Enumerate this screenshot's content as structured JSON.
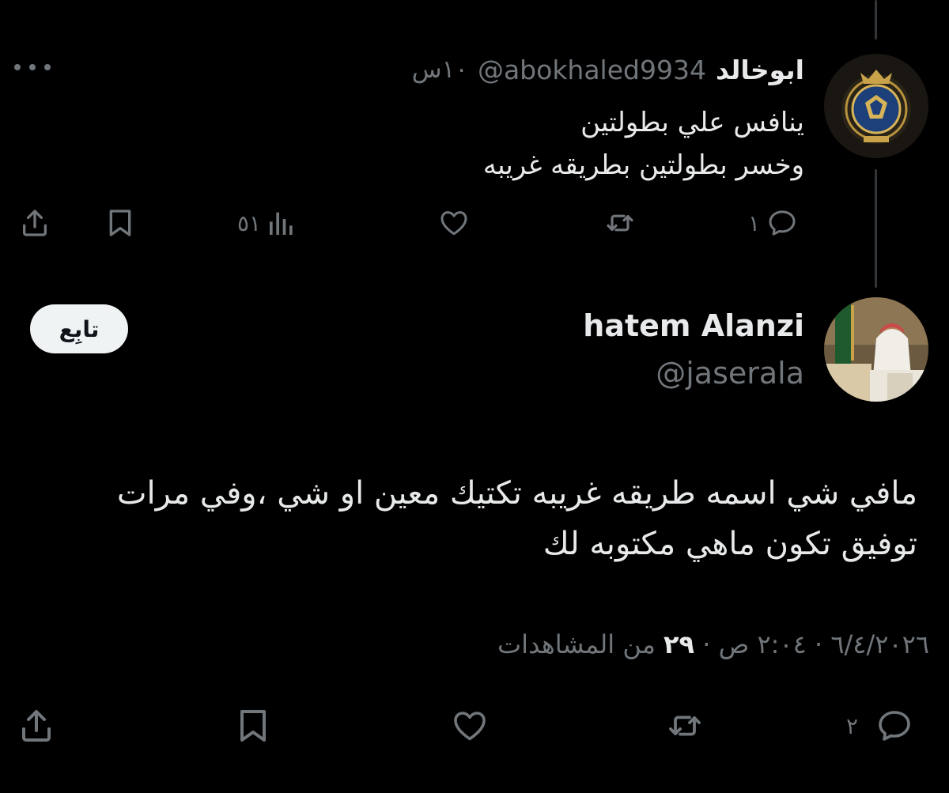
{
  "colors": {
    "background": "#000000",
    "primary_text": "#e7e9ea",
    "secondary_text": "#71767b",
    "follow_bg": "#eff3f4"
  },
  "reply": {
    "author_name": "ابوخالد",
    "handle": "@abokhaled9934",
    "time": "١٠س",
    "text_lines": [
      "ينافس علي بطولتين",
      "وخسر بطولتين بطريقه غريبه"
    ],
    "avatar_icon": "club-crest-avatar",
    "actions": {
      "reply_count": "١",
      "retweet_count": "",
      "like_count": "",
      "views_count": "٥١",
      "icons": [
        "reply-icon",
        "retweet-icon",
        "like-icon",
        "views-icon",
        "bookmark-icon",
        "share-icon"
      ]
    }
  },
  "main_tweet": {
    "author_name": "hatem Alanzi",
    "handle": "@jaserala",
    "follow_label": "تابِع",
    "text_lines": [
      "مافي شي اسمه طريقه غريبه تكتيك معين او شي ،وفي مرات",
      "توفيق تكون ماهي مكتوبه لك"
    ],
    "timestamp": "٦/٤/٢٠٢٦ · ٢:٠٤ ص · ",
    "views_number": "٢٩",
    "views_label": " من المشاهدات",
    "actions": {
      "reply_count": "٢",
      "icons": [
        "reply-icon",
        "retweet-icon",
        "like-icon",
        "bookmark-icon",
        "share-icon"
      ]
    }
  }
}
